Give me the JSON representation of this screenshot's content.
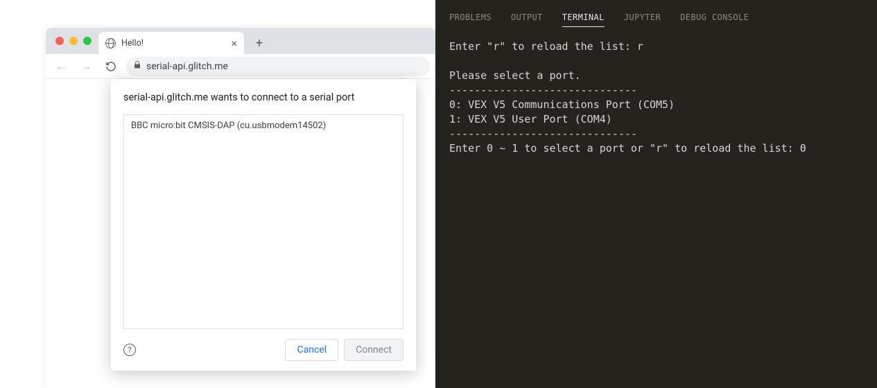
{
  "browser": {
    "tab_title": "Hello!",
    "url": "serial-api.glitch.me"
  },
  "dialog": {
    "title": "serial-api.glitch.me wants to connect to a serial port",
    "items": [
      "BBC micro:bit CMSIS-DAP (cu.usbmodem14502)"
    ],
    "cancel_label": "Cancel",
    "connect_label": "Connect"
  },
  "panel": {
    "tabs": {
      "problems": "PROBLEMS",
      "output": "OUTPUT",
      "terminal": "TERMINAL",
      "jupyter": "JUPYTER",
      "debug_console": "DEBUG CONSOLE"
    }
  },
  "terminal": {
    "line1": "Enter \"r\" to reload the list: r",
    "blank1": "",
    "line2": "Please select a port.",
    "sep1": "------------------------------",
    "port0": "0: VEX V5 Communications Port (COM5)",
    "port1": "1: VEX V5 User Port (COM4)",
    "sep2": "------------------------------",
    "prompt": "Enter 0 ~ 1 to select a port or \"r\" to reload the list: 0"
  }
}
